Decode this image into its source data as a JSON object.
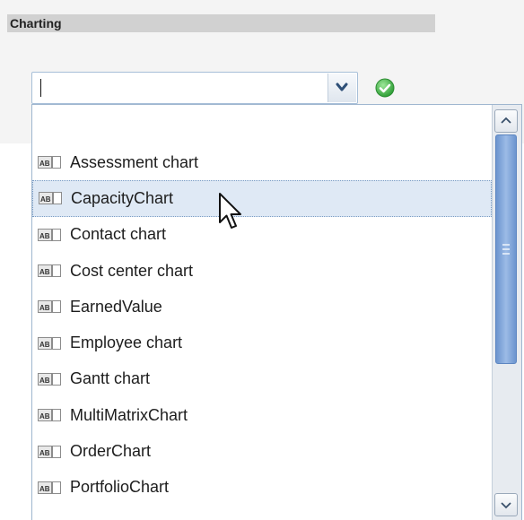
{
  "section": {
    "title": "Charting"
  },
  "combo": {
    "value": "",
    "dropdown_icon": "chevron-down-icon",
    "confirm_icon": "check-circle-icon"
  },
  "dropdown": {
    "items": [
      {
        "label": "Assessment chart",
        "icon": "text-field-icon"
      },
      {
        "label": "CapacityChart",
        "icon": "text-field-icon",
        "hovered": true
      },
      {
        "label": "Contact chart",
        "icon": "text-field-icon"
      },
      {
        "label": "Cost center chart",
        "icon": "text-field-icon"
      },
      {
        "label": "EarnedValue",
        "icon": "text-field-icon"
      },
      {
        "label": "Employee chart",
        "icon": "text-field-icon"
      },
      {
        "label": "Gantt chart",
        "icon": "text-field-icon"
      },
      {
        "label": "MultiMatrixChart",
        "icon": "text-field-icon"
      },
      {
        "label": "OrderChart",
        "icon": "text-field-icon"
      },
      {
        "label": "PortfolioChart",
        "icon": "text-field-icon"
      }
    ]
  },
  "colors": {
    "hover_bg": "#dfe9f5",
    "scroll_thumb": "#7fa6dc",
    "ok_green": "#43b543"
  }
}
